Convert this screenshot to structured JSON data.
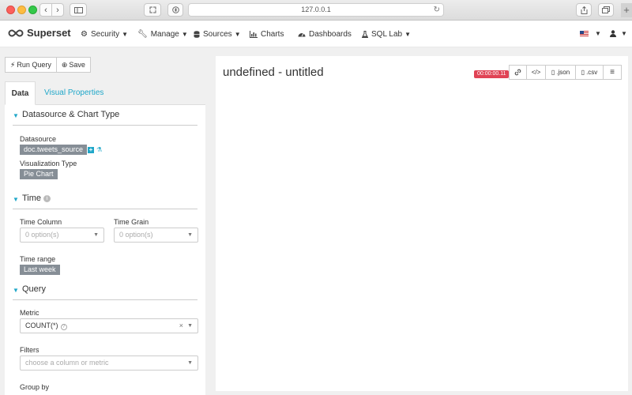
{
  "browser": {
    "url": "127.0.0.1"
  },
  "navbar": {
    "brand": "Superset",
    "items": [
      {
        "label": "Security",
        "icon": "gears-icon",
        "has_caret": true
      },
      {
        "label": "Manage",
        "icon": "wrench-icon",
        "has_caret": true
      },
      {
        "label": "Sources",
        "icon": "database-icon",
        "has_caret": true
      },
      {
        "label": "Charts",
        "icon": "bar-chart-icon",
        "has_caret": false
      },
      {
        "label": "Dashboards",
        "icon": "dashboard-icon",
        "has_caret": false
      },
      {
        "label": "SQL Lab",
        "icon": "flask-icon",
        "has_caret": true
      }
    ],
    "language_flag": "us-flag-icon",
    "user_icon": "user-icon"
  },
  "toolbar": {
    "run_query_label": "Run Query",
    "save_label": "Save"
  },
  "tabs": {
    "data_label": "Data",
    "visual_label": "Visual Properties"
  },
  "sections": {
    "datasource_chart_type": {
      "title": "Datasource & Chart Type",
      "datasource_label": "Datasource",
      "datasource_value": "doc.tweets_source",
      "viz_type_label": "Visualization Type",
      "viz_type_value": "Pie Chart"
    },
    "time": {
      "title": "Time",
      "time_column_label": "Time Column",
      "time_column_placeholder": "0 option(s)",
      "time_grain_label": "Time Grain",
      "time_grain_placeholder": "0 option(s)",
      "time_range_label": "Time range",
      "time_range_value": "Last week"
    },
    "query": {
      "title": "Query",
      "metric_label": "Metric",
      "metric_value": "COUNT(*)",
      "filters_label": "Filters",
      "filters_placeholder": "choose a column or metric",
      "group_by_label": "Group by"
    }
  },
  "chart_panel": {
    "title": "undefined - untitled",
    "timer": "00:00:00.11",
    "actions": {
      "link_icon": "link-icon",
      "embed_icon": "code-icon",
      "json_label": ".json",
      "csv_label": ".csv",
      "menu_icon": "hamburger-icon"
    }
  },
  "colors": {
    "accent": "#20a7c9",
    "tag_bg": "#868e96",
    "timer_bg": "#e04355"
  }
}
